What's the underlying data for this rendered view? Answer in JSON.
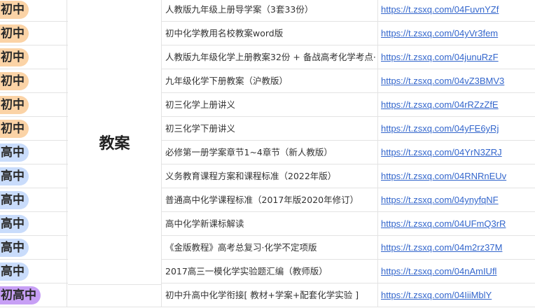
{
  "category": "教案",
  "colors": {
    "junior": "#fbd3a6",
    "senior": "#c9dcfb",
    "bridge": "#c79ff5",
    "link": "#3366cc"
  },
  "rows": [
    {
      "level": "初中",
      "type": "junior",
      "title": "人教版九年级上册导学案（3套33份）",
      "link": "https://t.zsxq.com/04FuvnYZf"
    },
    {
      "level": "初中",
      "type": "junior",
      "title": "初中化学教用名校教案word版",
      "link": "https://t.zsxq.com/04yVr3fem"
    },
    {
      "level": "初中",
      "type": "junior",
      "title": "人教版九年级化学上册教案32份 + 备战高考化学考点·",
      "link": "https://t.zsxq.com/04junuRzF"
    },
    {
      "level": "初中",
      "type": "junior",
      "title": "九年级化学下册教案（沪教版）",
      "link": "https://t.zsxq.com/04vZ3BMV3"
    },
    {
      "level": "初中",
      "type": "junior",
      "title": "初三化学上册讲义",
      "link": "https://t.zsxq.com/04rRZzZfE"
    },
    {
      "level": "初中",
      "type": "junior",
      "title": "初三化学下册讲义",
      "link": "https://t.zsxq.com/04yFE6yRj"
    },
    {
      "level": "高中",
      "type": "senior",
      "title": "必修第一册学案章节1~4章节（新人教版）",
      "link": "https://t.zsxq.com/04YrN3ZRJ"
    },
    {
      "level": "高中",
      "type": "senior",
      "title": "义务教育课程方案和课程标准（2022年版）",
      "link": "https://t.zsxq.com/04RNRnEUv"
    },
    {
      "level": "高中",
      "type": "senior",
      "title": "普通高中化学课程标准（2017年版2020年修订）",
      "link": "https://t.zsxq.com/04ynyfqNF"
    },
    {
      "level": "高中",
      "type": "senior",
      "title": "高中化学新课标解读",
      "link": "https://t.zsxq.com/04UFmQ3rR"
    },
    {
      "level": "高中",
      "type": "senior",
      "title": "《金版教程》高考总复习·化学不定项版",
      "link": "https://t.zsxq.com/04m2rz37M"
    },
    {
      "level": "高中",
      "type": "senior",
      "title": "2017高三一模化学实验题汇编（教师版）",
      "link": "https://t.zsxq.com/04nAmIUfl"
    },
    {
      "level": "初高中",
      "type": "bridge",
      "title": "初中升高中化学衔接[ 教材+学案+配套化学实验 ]",
      "link": "https://t.zsxq.com/04IiiMblY"
    }
  ]
}
